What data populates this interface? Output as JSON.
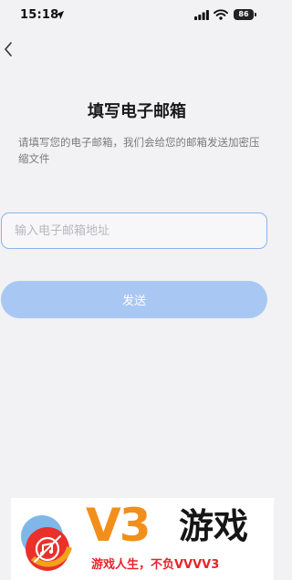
{
  "status_bar": {
    "time": "15:18",
    "battery": "86"
  },
  "header": {
    "back_icon": "chevron-left-icon"
  },
  "page": {
    "title": "填写电子邮箱",
    "description": "请填写您的电子邮箱，我们会给您的邮箱发送加密压缩文件"
  },
  "form": {
    "email_placeholder": "输入电子邮箱地址",
    "email_value": "",
    "send_label": "发送"
  },
  "watermark": {
    "brand": "V3",
    "brand_cn": "游戏",
    "slogan": "游戏人生，不负VVVV3"
  },
  "colors": {
    "background": "#f2f2f4",
    "input_border": "#8ab2ec",
    "button_disabled": "#a9c7f3",
    "brand_orange": "#f28f1c",
    "brand_red": "#e8232a"
  }
}
